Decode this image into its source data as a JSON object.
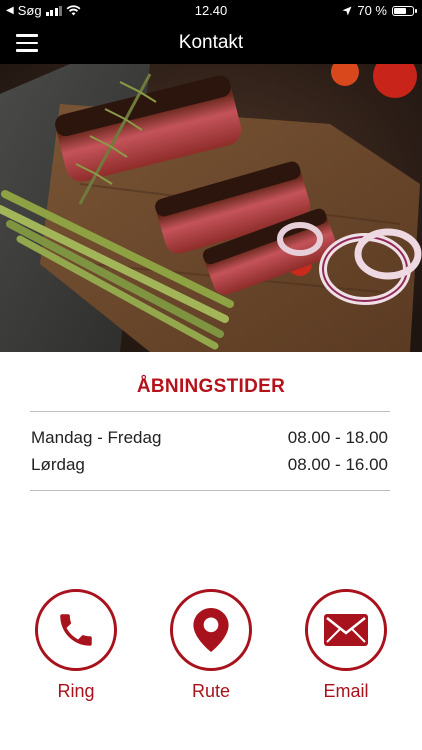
{
  "status_bar": {
    "carrier": "Søg",
    "time": "12.40",
    "battery": "70 %",
    "battery_level": 0.7
  },
  "navbar": {
    "title": "Kontakt",
    "menu_icon": "hamburger-menu-icon"
  },
  "hero": {
    "icon": "steak-photo"
  },
  "hours": {
    "title": "ÅBNINGSTIDER",
    "rows": [
      {
        "day": "Mandag - Fredag",
        "time": "08.00 - 18.00"
      },
      {
        "day": "Lørdag",
        "time": "08.00 - 16.00"
      }
    ]
  },
  "actions": [
    {
      "label": "Ring",
      "icon": "phone-icon"
    },
    {
      "label": "Rute",
      "icon": "map-pin-icon"
    },
    {
      "label": "Email",
      "icon": "envelope-icon"
    }
  ],
  "colors": {
    "accent": "#b5121b",
    "bar": "#000000"
  }
}
